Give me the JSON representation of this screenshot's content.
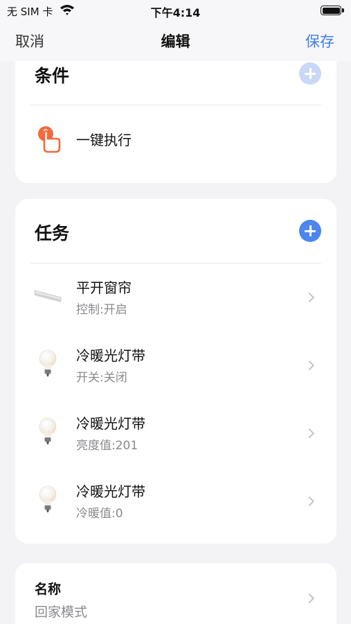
{
  "status_bar": {
    "carrier": "无 SIM 卡",
    "time": "下午4:14"
  },
  "nav": {
    "cancel": "取消",
    "title": "编辑",
    "save": "保存"
  },
  "condition": {
    "title": "条件",
    "item": {
      "label": "一键执行",
      "icon": "tap-hand-icon"
    }
  },
  "tasks": {
    "title": "任务",
    "items": [
      {
        "title": "平开窗帘",
        "subtitle": "控制:开启",
        "icon": "curtain-rail-icon"
      },
      {
        "title": "冷暖光灯带",
        "subtitle": "开关:关闭",
        "icon": "light-bulb-icon"
      },
      {
        "title": "冷暖光灯带",
        "subtitle": "亮度值:201",
        "icon": "light-bulb-icon"
      },
      {
        "title": "冷暖光灯带",
        "subtitle": "冷暖值:0",
        "icon": "light-bulb-icon"
      }
    ]
  },
  "name_section": {
    "label": "名称",
    "value": "回家模式"
  },
  "colors": {
    "accent": "#3f7ef0",
    "add_button": "#4c86ee",
    "tap_icon": "#f26a3d",
    "background": "#f3f3f5"
  }
}
